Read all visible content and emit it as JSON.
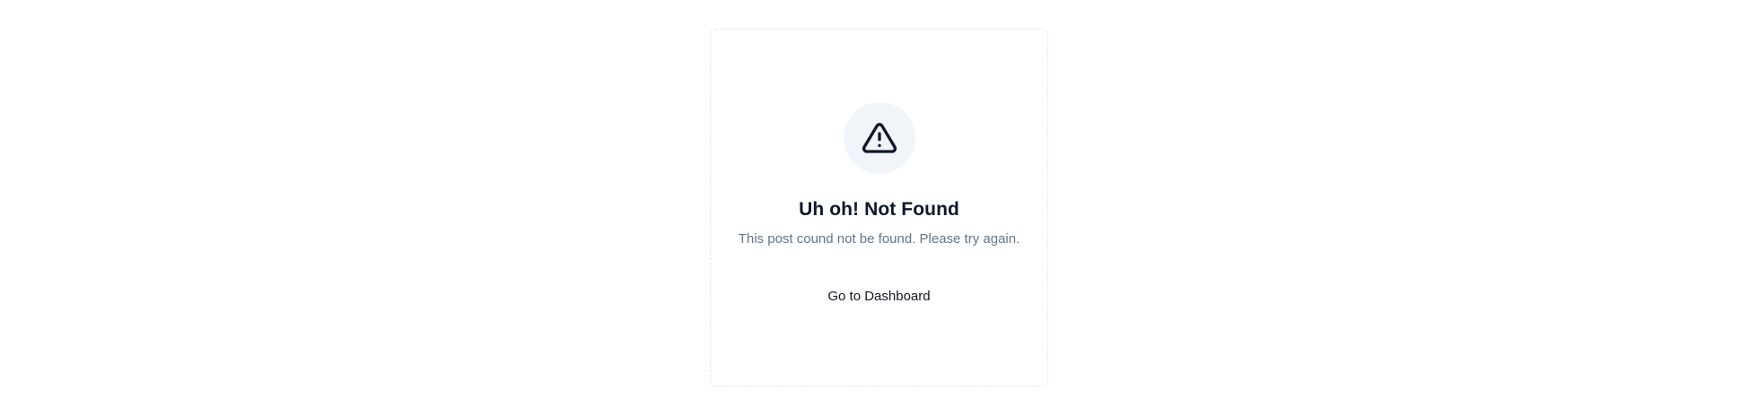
{
  "empty_state": {
    "icon": "alert-triangle-icon",
    "title": "Uh oh! Not Found",
    "message": "This post cound not be found. Please try again.",
    "action_label": "Go to Dashboard"
  },
  "colors": {
    "text_primary": "#0f172a",
    "text_muted": "#64748b",
    "icon_bg": "#f1f5f9",
    "border": "#e2e8f0"
  }
}
